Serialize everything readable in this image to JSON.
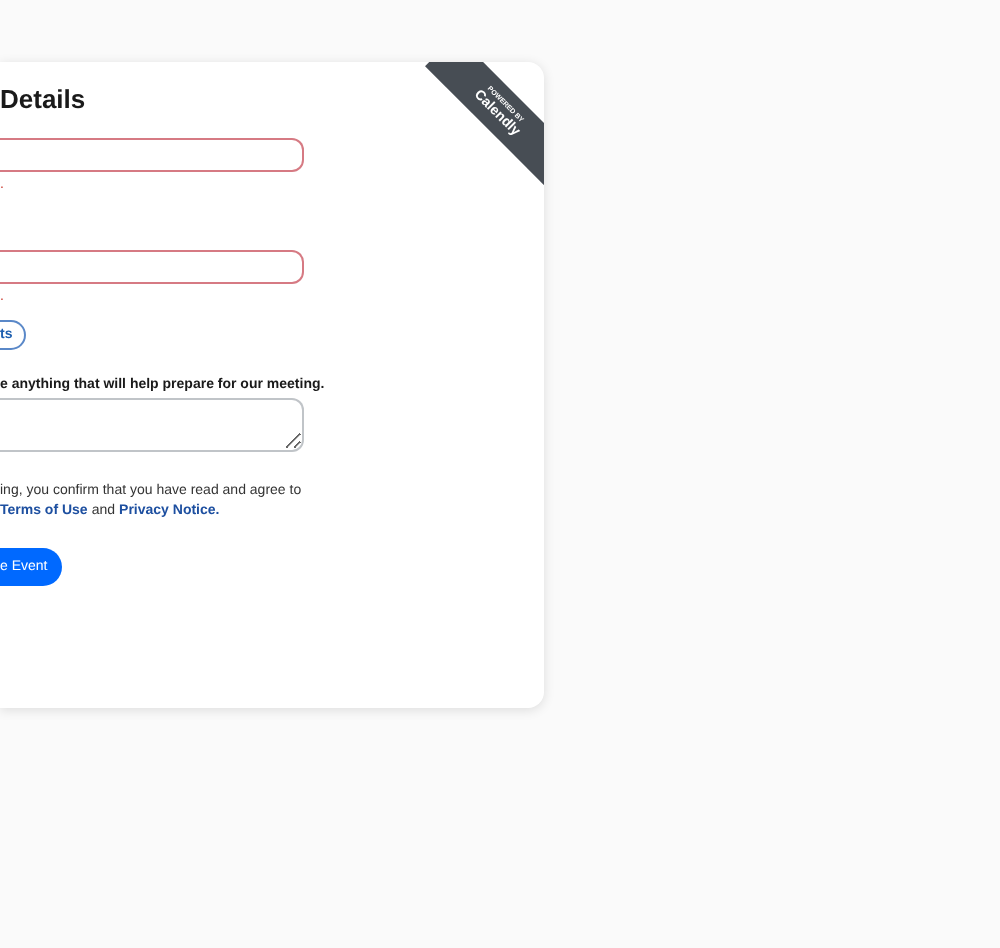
{
  "heading": "Details",
  "fields": [
    {
      "kind": "input",
      "invalid": true,
      "error": "."
    },
    {
      "kind": "input",
      "invalid": true,
      "error": "."
    }
  ],
  "add_guests_button": "ts",
  "notes": {
    "label": "e anything that will help prepare for our meeting.",
    "kind": "textarea"
  },
  "consent": {
    "line": "ing, you confirm that you have read and agree to",
    "links": [
      "Terms of Use",
      "Privacy Notice."
    ],
    "joiner": "and"
  },
  "submit_button": "e Event",
  "ribbon": {
    "small": "POWERED BY",
    "brand": "Calendly"
  }
}
